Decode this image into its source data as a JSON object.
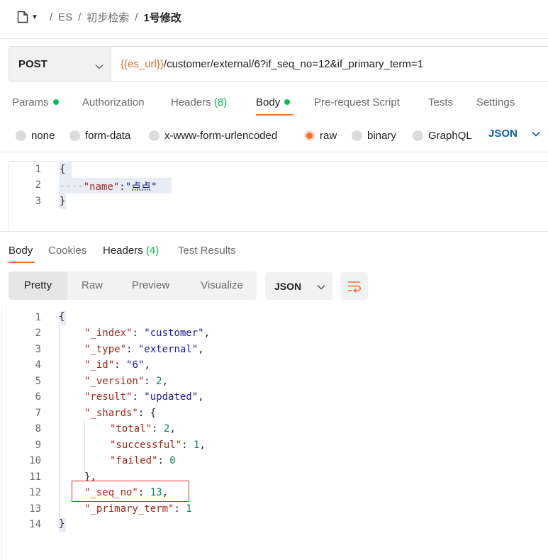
{
  "breadcrumb": {
    "items": [
      "ES",
      "初步检索"
    ],
    "current": "1号修改",
    "separator": "/"
  },
  "request": {
    "method": "POST",
    "url_var": "{{es_url}}",
    "url_rest": "/customer/external/6?if_seq_no=12&if_primary_term=1"
  },
  "request_tabs": {
    "params": "Params",
    "authorization": "Authorization",
    "headers": "Headers",
    "headers_count": "(8)",
    "body": "Body",
    "prerequest": "Pre-request Script",
    "tests": "Tests",
    "settings": "Settings"
  },
  "body_types": {
    "none": "none",
    "form_data": "form-data",
    "urlencoded": "x-www-form-urlencoded",
    "raw": "raw",
    "binary": "binary",
    "graphql": "GraphQL",
    "lang": "JSON"
  },
  "request_body": {
    "line_numbers": [
      "1",
      "2",
      "3"
    ],
    "open": "{",
    "indent": "····",
    "key": "\"name\"",
    "colon": ":",
    "value": "\"点点\"",
    "close": "}"
  },
  "response_tabs": {
    "body": "Body",
    "cookies": "Cookies",
    "headers": "Headers",
    "headers_count": "(4)",
    "test_results": "Test Results"
  },
  "view_modes": {
    "pretty": "Pretty",
    "raw": "Raw",
    "preview": "Preview",
    "visualize": "Visualize",
    "format": "JSON"
  },
  "response_body": {
    "line_numbers": [
      "1",
      "2",
      "3",
      "4",
      "5",
      "6",
      "7",
      "8",
      "9",
      "10",
      "11",
      "12",
      "13",
      "14"
    ],
    "l1": "{",
    "l2_key": "\"_index\"",
    "l2_val": "\"customer\"",
    "l3_key": "\"_type\"",
    "l3_val": "\"external\"",
    "l4_key": "\"_id\"",
    "l4_val": "\"6\"",
    "l5_key": "\"_version\"",
    "l5_val": "2",
    "l6_key": "\"result\"",
    "l6_val": "\"updated\"",
    "l7_key": "\"_shards\"",
    "l7_val": "{",
    "l8_key": "\"total\"",
    "l8_val": "2",
    "l9_key": "\"successful\"",
    "l9_val": "1",
    "l10_key": "\"failed\"",
    "l10_val": "0",
    "l11": "},",
    "l12_key": "\"_seq_no\"",
    "l12_val": "13",
    "l13_key": "\"_primary_term\"",
    "l13_val": "1",
    "l14": "}"
  },
  "colors": {
    "accent": "#ff6c37",
    "status_dot": "#0cbb52",
    "url_variable": "#e26b2a",
    "highlight_box": "#e0302e"
  }
}
